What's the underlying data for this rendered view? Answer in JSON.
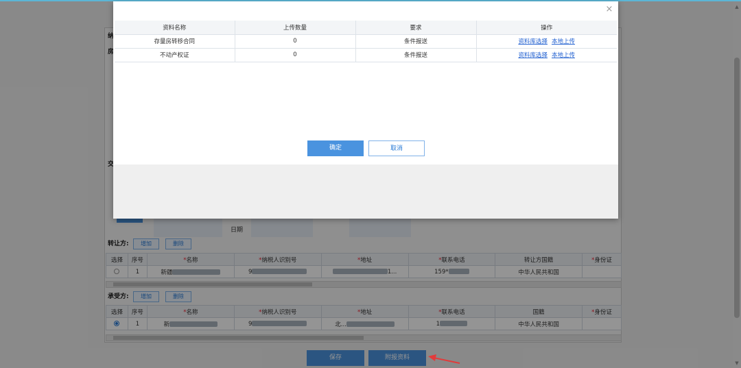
{
  "background_form": {
    "transferor": {
      "title": "转让方:",
      "add_label": "增加",
      "delete_label": "删除",
      "columns": [
        "选择",
        "序号",
        "*名称",
        "*纳税人识别号",
        "*地址",
        "*联系电话",
        "转让方国籍",
        "*身份证"
      ],
      "rows": [
        {
          "index": "1",
          "name": "新疆",
          "tax_id": "9",
          "address": "1...",
          "phone": "159*",
          "nationality": "中华人民共和国"
        }
      ]
    },
    "transferee": {
      "title": "承受方:",
      "add_label": "增加",
      "delete_label": "删除",
      "columns": [
        "选择",
        "序号",
        "*名称",
        "*纳税人识别号",
        "*地址",
        "*联系电话",
        "国籍",
        "*身份证"
      ],
      "rows": [
        {
          "index": "1",
          "name": "新",
          "tax_id": "9",
          "address": "北...",
          "phone": "1",
          "nationality": "中华人民共和国"
        }
      ]
    },
    "date_label": "日期",
    "side_labels": [
      "纳",
      "房",
      "交"
    ],
    "save_label": "保存",
    "attach_label": "附报资料"
  },
  "modal": {
    "close_symbol": "×",
    "columns": [
      "资料名称",
      "上传数量",
      "要求",
      "操作"
    ],
    "rows": [
      {
        "name": "存量房转移合同",
        "count": "0",
        "requirement": "条件报送",
        "action_select": "资料库选择",
        "action_upload": "本地上传"
      },
      {
        "name": "不动产权证",
        "count": "0",
        "requirement": "条件报送",
        "action_select": "资料库选择",
        "action_upload": "本地上传"
      }
    ],
    "confirm_label": "确定",
    "cancel_label": "取消"
  },
  "colors": {
    "primary": "#4a93df",
    "link": "#1f5fd0",
    "arrow": "#e23b3b"
  }
}
